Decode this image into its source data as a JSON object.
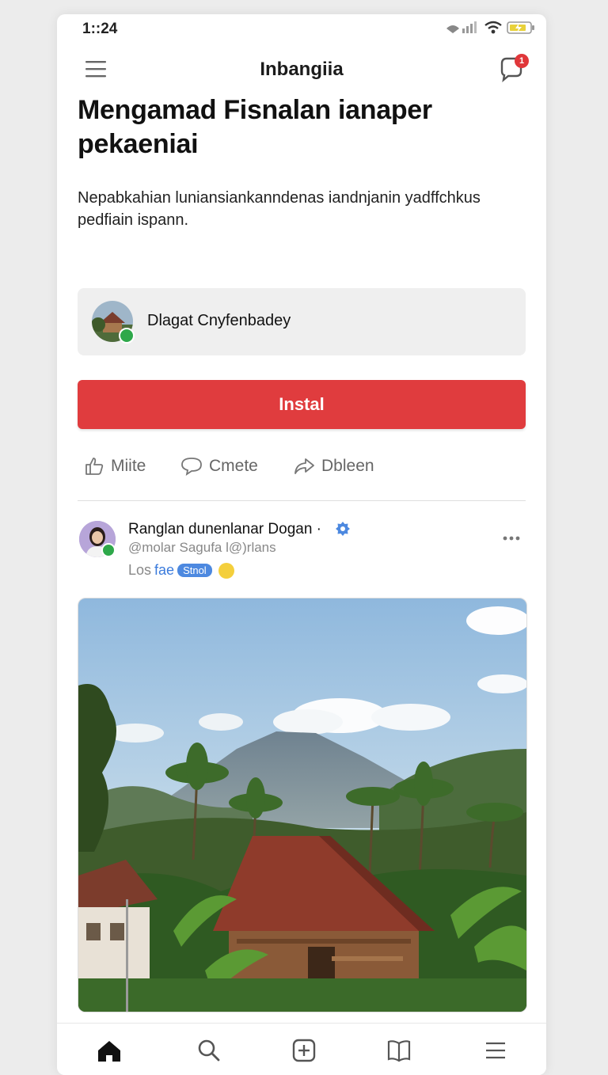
{
  "status_bar": {
    "time": "1::24"
  },
  "header": {
    "title": "Inbangiia",
    "notification_count": "1"
  },
  "hero": {
    "headline": "Mengamad Fisnalan ianaper pekaeniai",
    "description": "Nepabkahian luniansiankanndenas iandnjanin yadffchkus pedfiain ispann."
  },
  "developer": {
    "name": "Dlagat Cnyfenbadey"
  },
  "install_button": {
    "label": "Instal"
  },
  "actions": [
    {
      "icon": "thumbs-up-icon",
      "label": "Miite"
    },
    {
      "icon": "comment-icon",
      "label": "Cmete"
    },
    {
      "icon": "share-icon",
      "label": "Dbleen"
    }
  ],
  "post": {
    "author": "Ranglan dunenlanar Dogan ·",
    "handle": "@molar Sagufa l@)rlans",
    "meta_prefix": "Los",
    "meta_link": "fae",
    "meta_pill": "Stnol"
  },
  "bottom_nav": [
    {
      "icon": "home-icon"
    },
    {
      "icon": "search-icon"
    },
    {
      "icon": "add-icon"
    },
    {
      "icon": "book-icon"
    },
    {
      "icon": "menu-icon"
    }
  ],
  "colors": {
    "accent": "#e03c3e",
    "verified": "#4d89e0",
    "online": "#2ea84a"
  }
}
